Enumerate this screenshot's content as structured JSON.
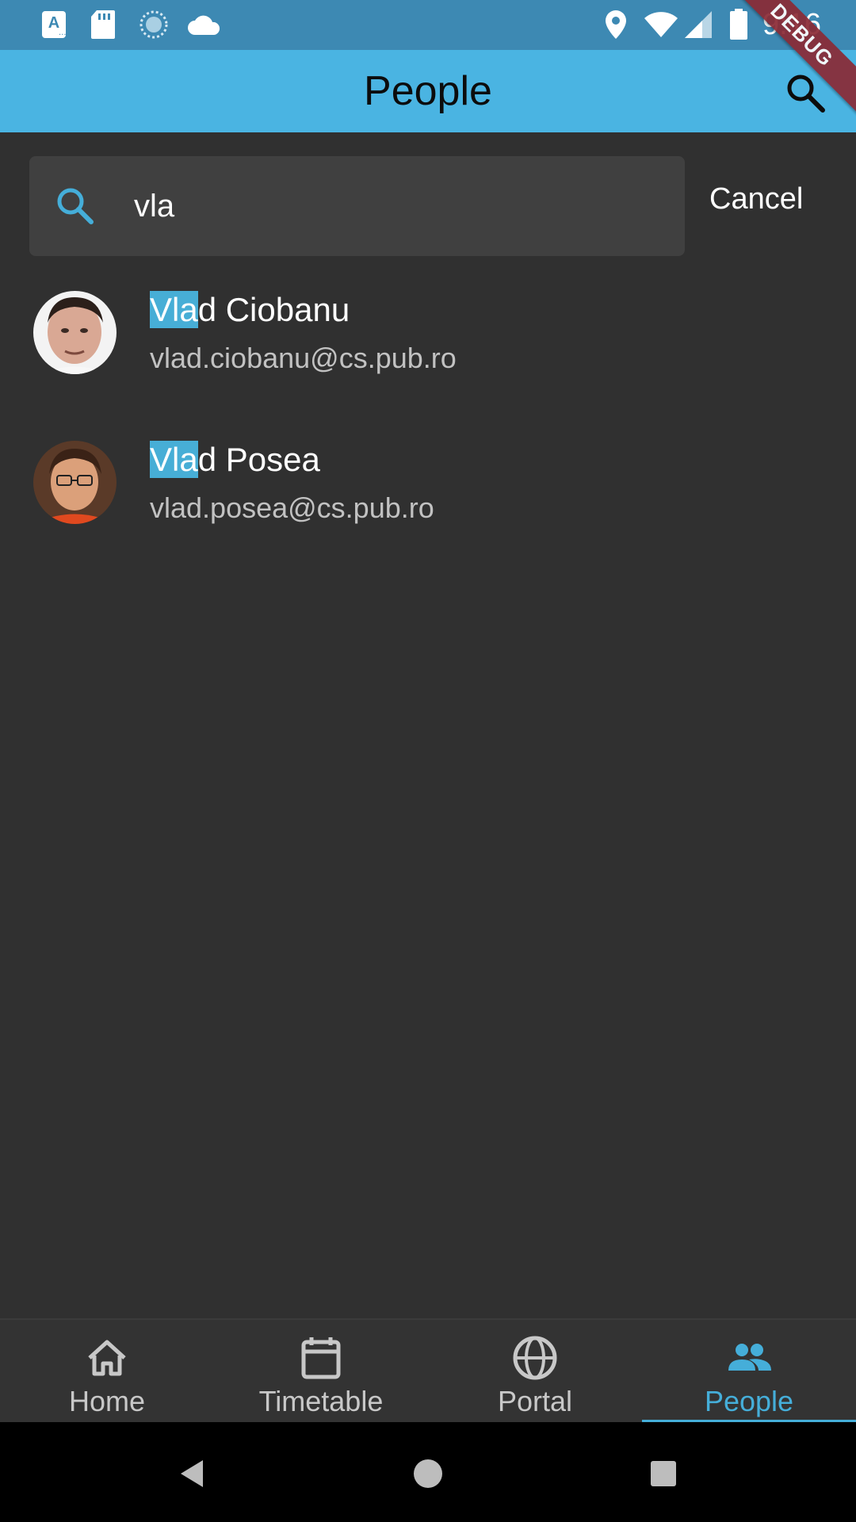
{
  "status_bar": {
    "time": "9:16",
    "left_icons": [
      "font-a-icon",
      "sd-card-icon",
      "sync-circle-icon",
      "cloud-icon"
    ],
    "right_icons": [
      "location-pin-icon",
      "wifi-icon",
      "signal-icon",
      "battery-icon"
    ]
  },
  "app_bar": {
    "title": "People",
    "debug_banner": "DEBUG"
  },
  "search": {
    "value": "vla",
    "cancel_label": "Cancel"
  },
  "results": [
    {
      "name_highlight": "Vla",
      "name_rest": "d Ciobanu",
      "email": "vlad.ciobanu@cs.pub.ro"
    },
    {
      "name_highlight": "Vla",
      "name_rest": "d Posea",
      "email": "vlad.posea@cs.pub.ro"
    }
  ],
  "bottom_nav": {
    "items": [
      {
        "label": "Home",
        "icon": "home-icon"
      },
      {
        "label": "Timetable",
        "icon": "calendar-icon"
      },
      {
        "label": "Portal",
        "icon": "globe-icon"
      },
      {
        "label": "People",
        "icon": "people-icon"
      }
    ],
    "active_index": 3
  },
  "colors": {
    "accent": "#45aed9",
    "app_bar": "#4ab4e2",
    "status_bar": "#3d89b3",
    "background": "#303030"
  }
}
